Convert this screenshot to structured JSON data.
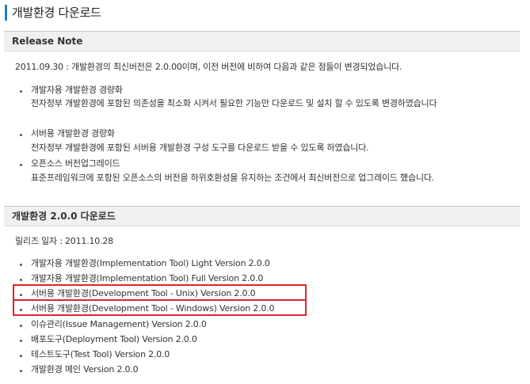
{
  "page_title": "개발환경 다운로드",
  "release_note": {
    "header": "Release Note",
    "intro": "2011.09.30 : 개발환경의 최신버전은 2.0.00이며, 이전 버전에 비하여 다음과 같은 점들이 변경되었습니다.",
    "items": [
      {
        "title": "개발자용 개발환경 경량화",
        "desc": "전자정부 개발환경에 포함된 의존성을 최소화 시켜서 필요한 기능만 다운로드 및 설치 할 수 있도록 변경하였습니다"
      },
      {
        "title": "서버용 개발환경 경량화",
        "desc": "전자정부 개발환경에 포함된 서버용 개발환경 구성 도구를 다운로드 받을 수 있도록 하였습니다."
      },
      {
        "title": "오픈소스 버전업그레이드",
        "desc": "표준프레임워크에 포함된 오픈소스의 버전을 하위호환성을 유지하는 조건에서 최신버전으로 업그레이드 했습니다."
      }
    ]
  },
  "download": {
    "header": "개발환경 2.0.0 다운로드",
    "release_date": "릴리즈 일자 : 2011.10.28",
    "links": [
      "개발자용 개발환경(Implementation Tool) Light Version 2.0.0",
      "개발자용 개발환경(Implementation Tool) Full Version 2.0.0",
      "서버용 개발환경(Development Tool - Unix) Version 2.0.0",
      "서버용 개발환경(Development Tool - Windows) Version 2.0.0",
      "이슈관리(Issue Management) Version 2.0.0",
      "배포도구(Deployment Tool) Version 2.0.0",
      "테스트도구(Test Tool) Version 2.0.0",
      "개발환경 메인 Version 2.0.0"
    ]
  },
  "colors": {
    "title_bar_accent": "#1f7fc1",
    "highlight_box": "#e0242b",
    "header_bg": "#f0f0f0"
  }
}
